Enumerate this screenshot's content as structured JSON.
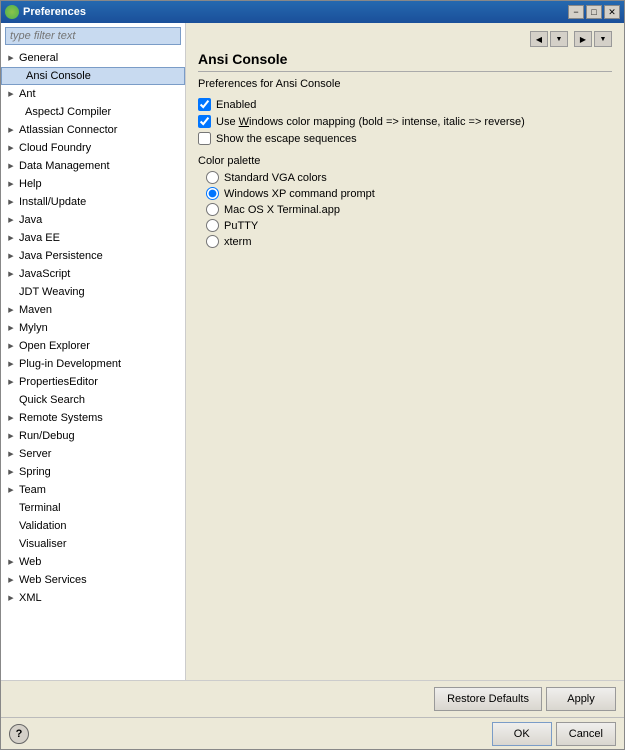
{
  "window": {
    "title": "Preferences",
    "title_buttons": {
      "minimize": "−",
      "maximize": "□",
      "close": "✕"
    }
  },
  "sidebar": {
    "filter_placeholder": "type filter text",
    "items": [
      {
        "id": "general",
        "label": "General",
        "level": 0,
        "arrow": "collapsed",
        "selected": false
      },
      {
        "id": "ansi-console",
        "label": "Ansi Console",
        "level": 1,
        "arrow": "none",
        "selected": true
      },
      {
        "id": "ant",
        "label": "Ant",
        "level": 0,
        "arrow": "collapsed",
        "selected": false
      },
      {
        "id": "aspectj-compiler",
        "label": "AspectJ Compiler",
        "level": 1,
        "arrow": "none",
        "selected": false
      },
      {
        "id": "atlassian-connector",
        "label": "Atlassian Connector",
        "level": 0,
        "arrow": "collapsed",
        "selected": false
      },
      {
        "id": "cloud-foundry",
        "label": "Cloud Foundry",
        "level": 0,
        "arrow": "collapsed",
        "selected": false
      },
      {
        "id": "data-management",
        "label": "Data Management",
        "level": 0,
        "arrow": "collapsed",
        "selected": false
      },
      {
        "id": "help",
        "label": "Help",
        "level": 0,
        "arrow": "collapsed",
        "selected": false
      },
      {
        "id": "install-update",
        "label": "Install/Update",
        "level": 0,
        "arrow": "collapsed",
        "selected": false
      },
      {
        "id": "java",
        "label": "Java",
        "level": 0,
        "arrow": "collapsed",
        "selected": false
      },
      {
        "id": "java-ee",
        "label": "Java EE",
        "level": 0,
        "arrow": "collapsed",
        "selected": false
      },
      {
        "id": "java-persistence",
        "label": "Java Persistence",
        "level": 0,
        "arrow": "collapsed",
        "selected": false
      },
      {
        "id": "javascript",
        "label": "JavaScript",
        "level": 0,
        "arrow": "collapsed",
        "selected": false
      },
      {
        "id": "jdt-weaving",
        "label": "JDT Weaving",
        "level": 0,
        "arrow": "none",
        "selected": false
      },
      {
        "id": "maven",
        "label": "Maven",
        "level": 0,
        "arrow": "collapsed",
        "selected": false
      },
      {
        "id": "mylyn",
        "label": "Mylyn",
        "level": 0,
        "arrow": "collapsed",
        "selected": false
      },
      {
        "id": "open-explorer",
        "label": "Open Explorer",
        "level": 0,
        "arrow": "collapsed",
        "selected": false
      },
      {
        "id": "plugin-development",
        "label": "Plug-in Development",
        "level": 0,
        "arrow": "collapsed",
        "selected": false
      },
      {
        "id": "properties-editor",
        "label": "PropertiesEditor",
        "level": 0,
        "arrow": "collapsed",
        "selected": false
      },
      {
        "id": "quick-search",
        "label": "Quick Search",
        "level": 0,
        "arrow": "none",
        "selected": false
      },
      {
        "id": "remote-systems",
        "label": "Remote Systems",
        "level": 0,
        "arrow": "collapsed",
        "selected": false
      },
      {
        "id": "run-debug",
        "label": "Run/Debug",
        "level": 0,
        "arrow": "collapsed",
        "selected": false
      },
      {
        "id": "server",
        "label": "Server",
        "level": 0,
        "arrow": "collapsed",
        "selected": false
      },
      {
        "id": "spring",
        "label": "Spring",
        "level": 0,
        "arrow": "collapsed",
        "selected": false
      },
      {
        "id": "team",
        "label": "Team",
        "level": 0,
        "arrow": "collapsed",
        "selected": false
      },
      {
        "id": "terminal",
        "label": "Terminal",
        "level": 0,
        "arrow": "none",
        "selected": false
      },
      {
        "id": "validation",
        "label": "Validation",
        "level": 0,
        "arrow": "none",
        "selected": false
      },
      {
        "id": "visualiser",
        "label": "Visualiser",
        "level": 0,
        "arrow": "none",
        "selected": false
      },
      {
        "id": "web",
        "label": "Web",
        "level": 0,
        "arrow": "collapsed",
        "selected": false
      },
      {
        "id": "web-services",
        "label": "Web Services",
        "level": 0,
        "arrow": "collapsed",
        "selected": false
      },
      {
        "id": "xml",
        "label": "XML",
        "level": 0,
        "arrow": "collapsed",
        "selected": false
      }
    ]
  },
  "right_panel": {
    "title": "Ansi Console",
    "subtitle": "Preferences for Ansi Console",
    "nav": {
      "back": "◀",
      "forward": "▶",
      "dropdown": "▼"
    },
    "options": {
      "enabled": {
        "label": "Enabled",
        "checked": true
      },
      "windows_color": {
        "label": "Use Windows color mapping (bold => intense, italic => reverse)",
        "checked": true
      },
      "escape_sequences": {
        "label": "Show the escape sequences",
        "checked": false
      }
    },
    "color_palette_label": "Color palette",
    "radio_options": [
      {
        "id": "standard-vga",
        "label": "Standard VGA colors",
        "selected": false
      },
      {
        "id": "windows-xp",
        "label": "Windows XP command prompt",
        "selected": true
      },
      {
        "id": "mac-osx",
        "label": "Mac OS X Terminal.app",
        "selected": false
      },
      {
        "id": "putty",
        "label": "PuTTY",
        "selected": false
      },
      {
        "id": "xterm",
        "label": "xterm",
        "selected": false
      }
    ]
  },
  "bottom_bar": {
    "restore_defaults_label": "Restore Defaults",
    "apply_label": "Apply"
  },
  "footer": {
    "ok_label": "OK",
    "cancel_label": "Cancel"
  }
}
